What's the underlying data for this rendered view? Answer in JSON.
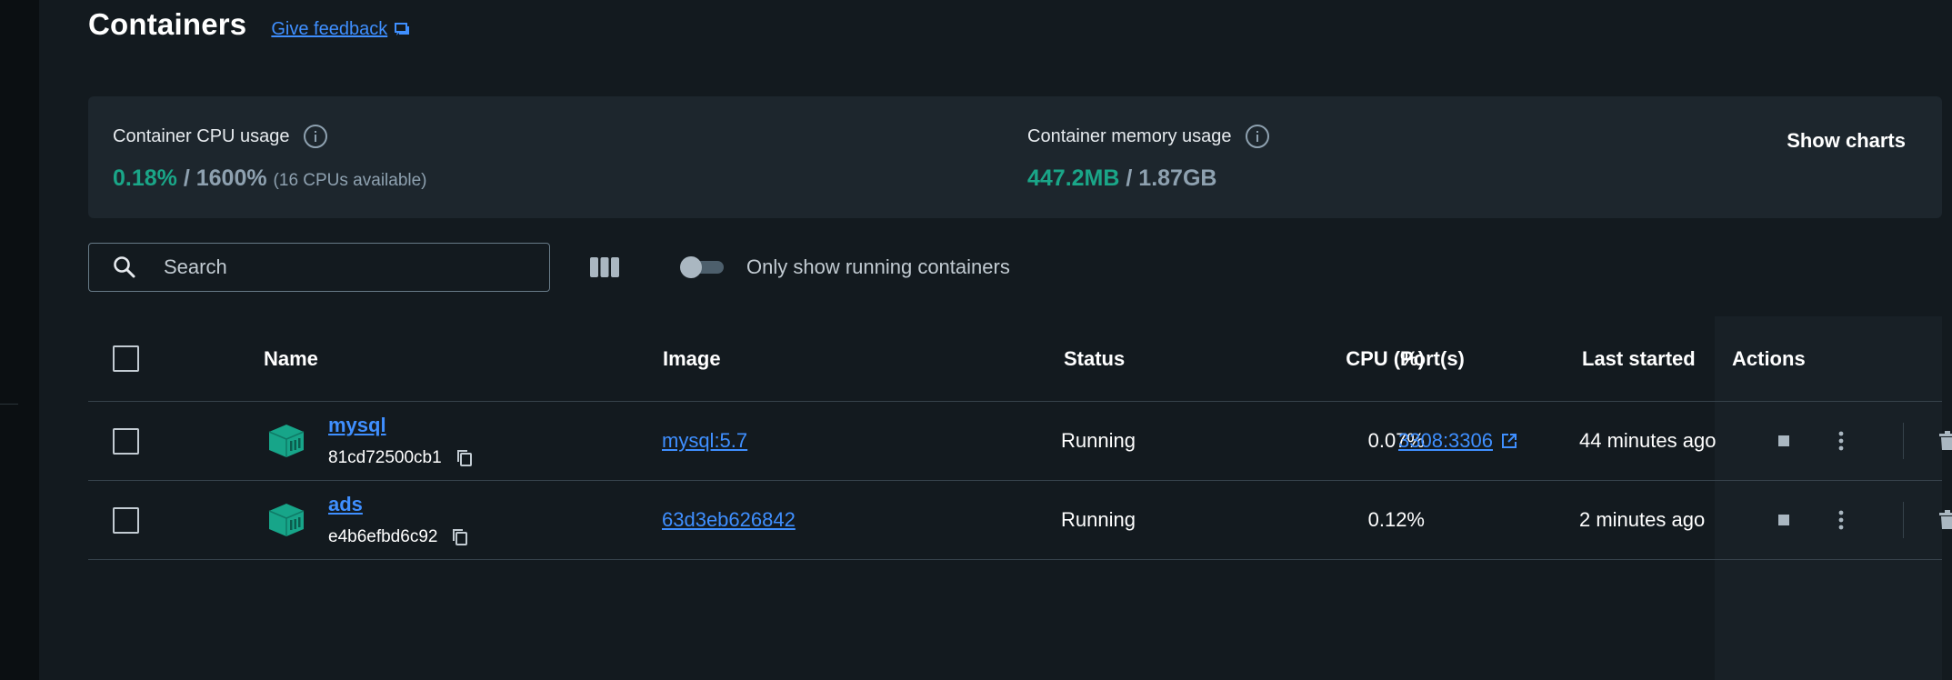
{
  "page": {
    "title": "Containers",
    "feedback_label": "Give feedback"
  },
  "usage": {
    "cpu_label": "Container CPU usage",
    "cpu_used": "0.18%",
    "cpu_separator": " / ",
    "cpu_total": "1600%",
    "cpu_note": "(16 CPUs available)",
    "mem_label": "Container memory usage",
    "mem_used": "447.2MB",
    "mem_separator": " / ",
    "mem_total": "1.87GB",
    "show_charts_label": "Show charts"
  },
  "toolbar": {
    "search_placeholder": "Search",
    "toggle_label": "Only show running containers"
  },
  "table": {
    "headers": {
      "name": "Name",
      "image": "Image",
      "status": "Status",
      "cpu": "CPU (%)",
      "ports": "Port(s)",
      "last_started": "Last started",
      "actions": "Actions"
    },
    "rows": [
      {
        "name": "mysql",
        "id": "81cd72500cb1",
        "image": "mysql:5.7",
        "status": "Running",
        "cpu": "0.07%",
        "ports": "3308:3306",
        "last_started": "44 minutes ago"
      },
      {
        "name": "ads",
        "id": "e4b6efbd6c92",
        "image": "63d3eb626842",
        "status": "Running",
        "cpu": "0.12%",
        "ports": "",
        "last_started": "2 minutes ago"
      }
    ]
  },
  "colors": {
    "background": "#131a1f",
    "panel": "#1d262d",
    "accent_link": "#3f8fff",
    "usage_green": "#1aa688",
    "container_icon": "#17a589"
  }
}
